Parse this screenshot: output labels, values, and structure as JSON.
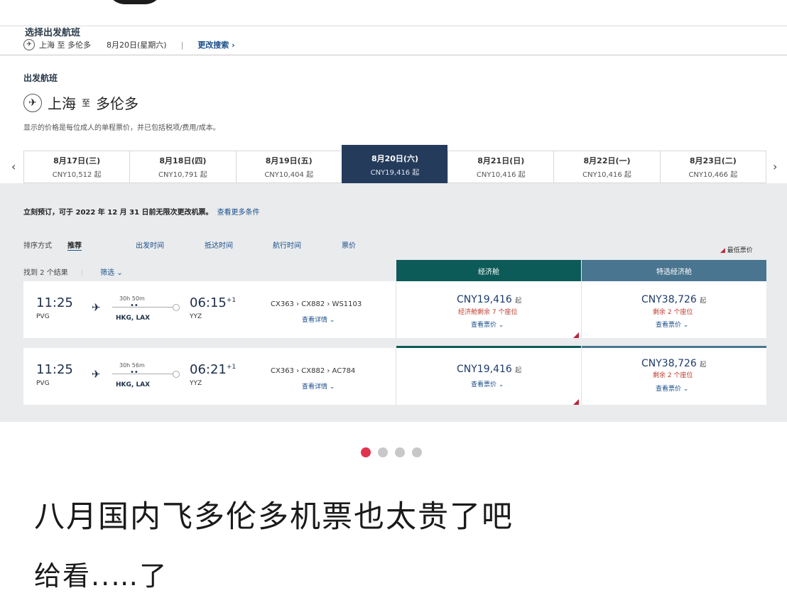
{
  "header": {
    "title": "选择出发航班",
    "route_short": "上海 至 多伦多",
    "date_short": "8月20日(星期六)",
    "modify": "更改搜索"
  },
  "section": {
    "label": "出发航班",
    "route_from": "上海",
    "route_to_word": "至",
    "route_to": "多伦多",
    "note": "显示的价格是每位成人的单程票价，并已包括税项/费用/成本。"
  },
  "dates": [
    {
      "date": "8月17日(三)",
      "price": "CNY10,512 起"
    },
    {
      "date": "8月18日(四)",
      "price": "CNY10,791 起"
    },
    {
      "date": "8月19日(五)",
      "price": "CNY10,404 起"
    },
    {
      "date": "8月20日(六)",
      "price": "CNY19,416 起",
      "active": true
    },
    {
      "date": "8月21日(日)",
      "price": "CNY10,416 起"
    },
    {
      "date": "8月22日(一)",
      "price": "CNY10,416 起"
    },
    {
      "date": "8月23日(二)",
      "price": "CNY10,466 起"
    }
  ],
  "booking_note": {
    "text": "立刻预订，可于 2022 年 12 月 31 日前无限次更改机票。",
    "link": "查看更多条件"
  },
  "sort": {
    "label": "排序方式",
    "options": [
      "推荐",
      "出发时间",
      "抵达时间",
      "航行时间",
      "票价"
    ]
  },
  "lowest_price_label": "最低票价",
  "results": {
    "found": "找到 2 个结果",
    "filter": "筛选"
  },
  "cabins": {
    "economy": "经济舱",
    "premium": "特选经济舱"
  },
  "flights": [
    {
      "dep_time": "11:25",
      "dep_code": "PVG",
      "duration": "30h 50m",
      "stops": "HKG, LAX",
      "arr_time": "06:15",
      "arr_plus": "+1",
      "arr_code": "YYZ",
      "flight_nos": "CX363 › CX882 › WS1103",
      "details": "查看详情",
      "econ_price": "CNY19,416",
      "econ_seat": "经济舱剩余 7 个座位",
      "prem_price": "CNY38,726",
      "prem_seat": "剩余 2 个座位",
      "view_fare": "查看票价"
    },
    {
      "dep_time": "11:25",
      "dep_code": "PVG",
      "duration": "30h 56m",
      "stops": "HKG, LAX",
      "arr_time": "06:21",
      "arr_plus": "+1",
      "arr_code": "YYZ",
      "flight_nos": "CX363 › CX882 › AC784",
      "details": "查看详情",
      "econ_price": "CNY19,416",
      "prem_price": "CNY38,726",
      "prem_seat": "剩余 2 个座位",
      "view_fare": "查看票价"
    }
  ],
  "carousel": {
    "total": 4,
    "active": 1
  },
  "post": {
    "title": "八月国内飞多伦多机票也太贵了吧",
    "body": "给看..…了"
  },
  "colors": {
    "economy_header": "#0d5b58",
    "premium_header": "#4a7590",
    "active_date": "#243b5c",
    "carousel_active": "#e0334c"
  }
}
